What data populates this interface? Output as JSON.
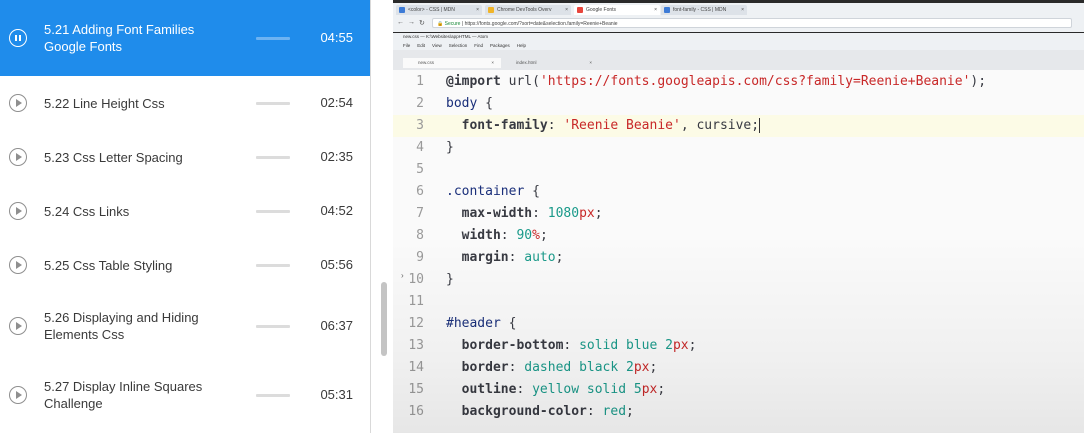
{
  "playlist": {
    "items": [
      {
        "title": "5.21 Adding Font Families Google Fonts",
        "title_lines": [
          "5.21 Adding Font Families",
          "Google Fonts"
        ],
        "duration": "04:55",
        "active": true
      },
      {
        "title": "5.22 Line Height Css",
        "title_lines": [
          "5.22 Line Height Css"
        ],
        "duration": "02:54",
        "active": false
      },
      {
        "title": "5.23 Css Letter Spacing",
        "title_lines": [
          "5.23 Css Letter Spacing"
        ],
        "duration": "02:35",
        "active": false
      },
      {
        "title": "5.24 Css Links",
        "title_lines": [
          "5.24 Css Links"
        ],
        "duration": "04:52",
        "active": false
      },
      {
        "title": "5.25 Css Table Styling",
        "title_lines": [
          "5.25 Css Table Styling"
        ],
        "duration": "05:56",
        "active": false
      },
      {
        "title": "5.26 Displaying and Hiding Elements Css",
        "title_lines": [
          "5.26 Displaying and Hiding",
          "Elements Css"
        ],
        "duration": "06:37",
        "active": false
      },
      {
        "title": "5.27 Display Inline Squares Challenge",
        "title_lines": [
          "5.27 Display Inline Squares",
          "Challenge"
        ],
        "duration": "05:31",
        "active": false
      }
    ]
  },
  "browser": {
    "tabs": [
      {
        "label": "<color> - CSS | MDN",
        "favicon_color": "#3d7bd6"
      },
      {
        "label": "Chrome DevTools Overv",
        "favicon_color": "#f0b429"
      },
      {
        "label": "Google Fonts",
        "favicon_color": "#e8453c"
      },
      {
        "label": "font-family - CSS | MDN",
        "favicon_color": "#3d7bd6"
      }
    ],
    "secure_label": "Secure",
    "url": "https://fonts.google.com/?sort=date&selection.family=Reenie+Beanie"
  },
  "atom": {
    "window_title": "new.css — K:\\Websites\\appHTML — Atom",
    "menu": [
      "File",
      "Edit",
      "View",
      "Selection",
      "Find",
      "Packages",
      "Help"
    ],
    "tabs": [
      {
        "label": "new.css",
        "active": true
      },
      {
        "label": "index.html",
        "active": false
      }
    ]
  },
  "editor": {
    "current_line": 3,
    "lines": [
      {
        "n": "1",
        "tokens": [
          [
            "at",
            "@import"
          ],
          [
            "fn",
            " url("
          ],
          [
            "s",
            "'https://fonts.googleapis.com/css?family=Reenie+Beanie'"
          ],
          [
            "fn",
            ");"
          ]
        ]
      },
      {
        "n": "2",
        "tokens": [
          [
            "tag",
            "body"
          ],
          [
            "fn",
            " {"
          ]
        ]
      },
      {
        "n": "3",
        "tokens": [
          [
            "fn",
            "  "
          ],
          [
            "prop",
            "font-family"
          ],
          [
            "fn",
            ": "
          ],
          [
            "s",
            "'Reenie Beanie'"
          ],
          [
            "fn",
            ", cursive;"
          ]
        ]
      },
      {
        "n": "4",
        "tokens": [
          [
            "fn",
            "}"
          ]
        ]
      },
      {
        "n": "5",
        "tokens": []
      },
      {
        "n": "6",
        "tokens": [
          [
            "tag",
            ".container"
          ],
          [
            "fn",
            " {"
          ]
        ]
      },
      {
        "n": "7",
        "tokens": [
          [
            "fn",
            "  "
          ],
          [
            "prop",
            "max-width"
          ],
          [
            "fn",
            ": "
          ],
          [
            "num",
            "1080"
          ],
          [
            "unit",
            "px"
          ],
          [
            "fn",
            ";"
          ]
        ]
      },
      {
        "n": "8",
        "tokens": [
          [
            "fn",
            "  "
          ],
          [
            "prop",
            "width"
          ],
          [
            "fn",
            ": "
          ],
          [
            "num",
            "90"
          ],
          [
            "unit",
            "%"
          ],
          [
            "fn",
            ";"
          ]
        ]
      },
      {
        "n": "9",
        "tokens": [
          [
            "fn",
            "  "
          ],
          [
            "prop",
            "margin"
          ],
          [
            "fn",
            ": "
          ],
          [
            "kw",
            "auto"
          ],
          [
            "fn",
            ";"
          ]
        ]
      },
      {
        "n": "10",
        "tokens": [
          [
            "fn",
            "}"
          ]
        ]
      },
      {
        "n": "11",
        "tokens": []
      },
      {
        "n": "12",
        "tokens": [
          [
            "tag",
            "#header"
          ],
          [
            "fn",
            " {"
          ]
        ]
      },
      {
        "n": "13",
        "tokens": [
          [
            "fn",
            "  "
          ],
          [
            "prop",
            "border-bottom"
          ],
          [
            "fn",
            ": "
          ],
          [
            "kw",
            "solid blue "
          ],
          [
            "num",
            "2"
          ],
          [
            "unit",
            "px"
          ],
          [
            "fn",
            ";"
          ]
        ]
      },
      {
        "n": "14",
        "tokens": [
          [
            "fn",
            "  "
          ],
          [
            "prop",
            "border"
          ],
          [
            "fn",
            ": "
          ],
          [
            "kw",
            "dashed black "
          ],
          [
            "num",
            "2"
          ],
          [
            "unit",
            "px"
          ],
          [
            "fn",
            ";"
          ]
        ]
      },
      {
        "n": "15",
        "tokens": [
          [
            "fn",
            "  "
          ],
          [
            "prop",
            "outline"
          ],
          [
            "fn",
            ": "
          ],
          [
            "kw",
            "yellow solid "
          ],
          [
            "num",
            "5"
          ],
          [
            "unit",
            "px"
          ],
          [
            "fn",
            ";"
          ]
        ]
      },
      {
        "n": "16",
        "tokens": [
          [
            "fn",
            "  "
          ],
          [
            "prop",
            "background-color"
          ],
          [
            "fn",
            ": "
          ],
          [
            "kw",
            "red"
          ],
          [
            "fn",
            ";"
          ]
        ]
      }
    ]
  }
}
